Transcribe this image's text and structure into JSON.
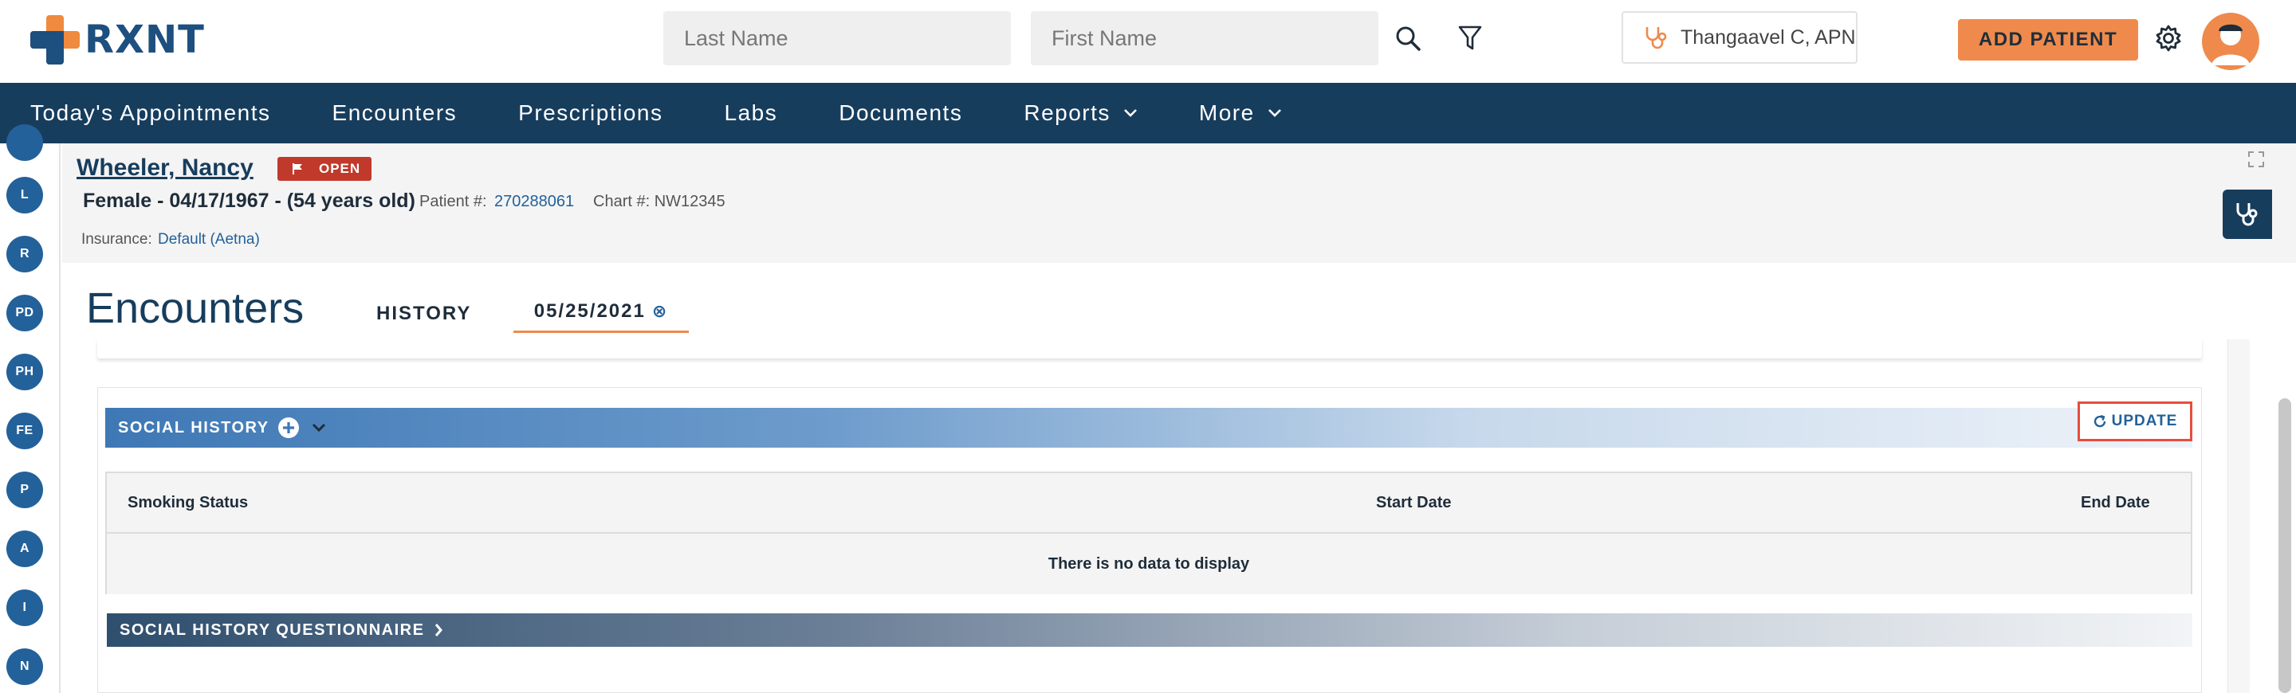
{
  "app": {
    "logo_text": "RXNT"
  },
  "search": {
    "last_name_placeholder": "Last Name",
    "first_name_placeholder": "First Name"
  },
  "header": {
    "provider": "Thangaavel C, APN",
    "add_patient": "ADD PATIENT"
  },
  "nav": {
    "items": [
      {
        "label": "Today's Appointments"
      },
      {
        "label": "Encounters"
      },
      {
        "label": "Prescriptions"
      },
      {
        "label": "Labs"
      },
      {
        "label": "Documents"
      },
      {
        "label": "Reports"
      },
      {
        "label": "More"
      }
    ]
  },
  "rail": {
    "items": [
      "L",
      "R",
      "PD",
      "PH",
      "FE",
      "P",
      "A",
      "I",
      "N"
    ]
  },
  "patient": {
    "name": "Wheeler, Nancy",
    "status": "OPEN",
    "demographics": "Female - 04/17/1967 - (54 years old)",
    "patient_num_label": "Patient #:",
    "patient_num": "270288061",
    "chart_label": "Chart #: NW12345",
    "insurance_label": "Insurance:",
    "insurance": "Default (Aetna)"
  },
  "encounters": {
    "title": "Encounters",
    "tabs": [
      {
        "label": "HISTORY"
      },
      {
        "label": "05/25/2021",
        "close": "⊗"
      }
    ]
  },
  "social_history": {
    "title": "SOCIAL HISTORY",
    "update": "UPDATE",
    "columns": [
      "Smoking Status",
      "Start Date",
      "End Date"
    ],
    "empty_message": "There is no data to display",
    "questionnaire": "SOCIAL HISTORY QUESTIONNAIRE"
  },
  "colors": {
    "brand_navy": "#173d5d",
    "accent_orange": "#ef8a4c",
    "link_blue": "#23619a",
    "alert_red": "#c0392b"
  }
}
